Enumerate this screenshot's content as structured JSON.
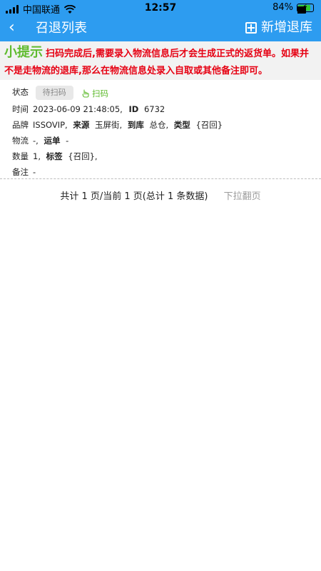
{
  "status_bar": {
    "carrier": "中国联通",
    "time": "12:57",
    "battery_text": "84%",
    "battery_level": 0.84
  },
  "nav": {
    "back_icon": "chevron-left-icon",
    "title": "召退列表",
    "add_label": "新增退库",
    "bg_color": "#2d9cf0"
  },
  "tip": {
    "title": "小提示",
    "text": "扫码完成后,需要录入物流信息后才会生成正式的返货单。如果并不是走物流的退库,那么在物流信息处录入自取或其他备注即可。",
    "title_color": "#5fbb2e",
    "text_color": "#e60012"
  },
  "record": {
    "status_label": "状态",
    "status_value": "待扫码",
    "scan_label": "扫码",
    "time_label": "时间",
    "time_value": "2023-06-09 21:48:05,",
    "id_label": "ID",
    "id_value": "6732",
    "brand_label": "品牌",
    "brand_value": "ISSOVIP,",
    "source_label": "来源",
    "source_value": "玉屏街,",
    "dest_label": "到库",
    "dest_value": "总仓,",
    "type_label": "类型",
    "type_value": "{召回}",
    "logistics_label": "物流",
    "logistics_value": "-,",
    "waybill_label": "运单",
    "waybill_value": "-",
    "qty_label": "数量",
    "qty_value": "1,",
    "tag_label": "标签",
    "tag_value": "{召回},",
    "note_label": "备注",
    "note_value": "-"
  },
  "pager": {
    "summary": "共计 1 页/当前 1 页(总计 1 条数据)",
    "more": "下拉翻页"
  }
}
